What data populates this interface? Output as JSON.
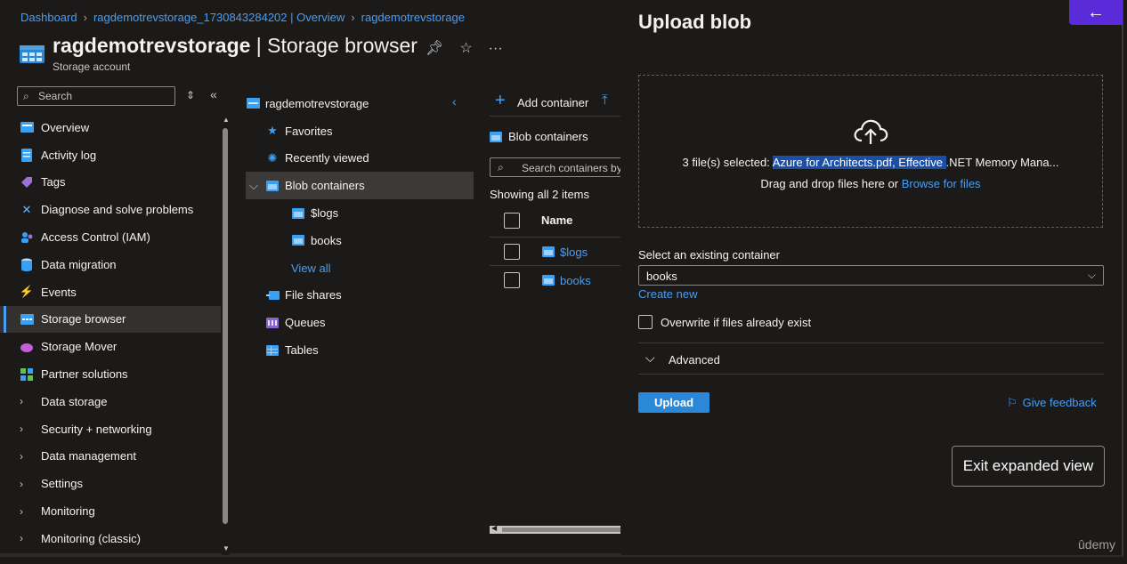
{
  "breadcrumb": [
    "Dashboard",
    "ragdemotrevstorage_1730843284202 | Overview",
    "ragdemotrevstorage"
  ],
  "header": {
    "title_bold": "ragdemotrevstorage",
    "title_rest": " | Storage browser",
    "subtitle": "Storage account"
  },
  "sidebar": {
    "search_placeholder": "Search",
    "items": [
      {
        "label": "Overview",
        "icon": "overview-icon"
      },
      {
        "label": "Activity log",
        "icon": "activity-log-icon"
      },
      {
        "label": "Tags",
        "icon": "tag-icon"
      },
      {
        "label": "Diagnose and solve problems",
        "icon": "wrench-icon"
      },
      {
        "label": "Access Control (IAM)",
        "icon": "people-icon"
      },
      {
        "label": "Data migration",
        "icon": "database-icon"
      },
      {
        "label": "Events",
        "icon": "lightning-icon"
      },
      {
        "label": "Storage browser",
        "icon": "storage-icon"
      },
      {
        "label": "Storage Mover",
        "icon": "cloud-mover-icon"
      },
      {
        "label": "Partner solutions",
        "icon": "partner-icon"
      },
      {
        "label": "Data storage",
        "icon": "chevron-right-icon"
      },
      {
        "label": "Security + networking",
        "icon": "chevron-right-icon"
      },
      {
        "label": "Data management",
        "icon": "chevron-right-icon"
      },
      {
        "label": "Settings",
        "icon": "chevron-right-icon"
      },
      {
        "label": "Monitoring",
        "icon": "chevron-right-icon"
      },
      {
        "label": "Monitoring (classic)",
        "icon": "chevron-right-icon"
      }
    ]
  },
  "tree": {
    "root": "ragdemotrevstorage",
    "items": [
      "Favorites",
      "Recently viewed",
      "Blob containers",
      "$logs",
      "books",
      "View all",
      "File shares",
      "Queues",
      "Tables"
    ]
  },
  "middle": {
    "add_container": "Add container",
    "section": "Blob containers",
    "search_placeholder": "Search containers by",
    "showing": "Showing all 2 items",
    "col_name": "Name",
    "rows": [
      "$logs",
      "books"
    ]
  },
  "upload": {
    "title": "Upload blob",
    "files_prefix": "3 file(s) selected: ",
    "files_highlight": "Azure for Architects.pdf, Effective ",
    "files_rest": ".NET Memory Mana...",
    "drag_text": "Drag and drop files here  or ",
    "browse_link": "Browse for files",
    "container_label": "Select an existing container",
    "container_value": "books",
    "create_new": "Create new",
    "overwrite_label": "Overwrite if files already exist",
    "advanced": "Advanced",
    "upload_button": "Upload",
    "feedback": "Give feedback"
  },
  "overlay": {
    "exit_expanded": "Exit expanded view",
    "watermark": "ûdemy"
  }
}
